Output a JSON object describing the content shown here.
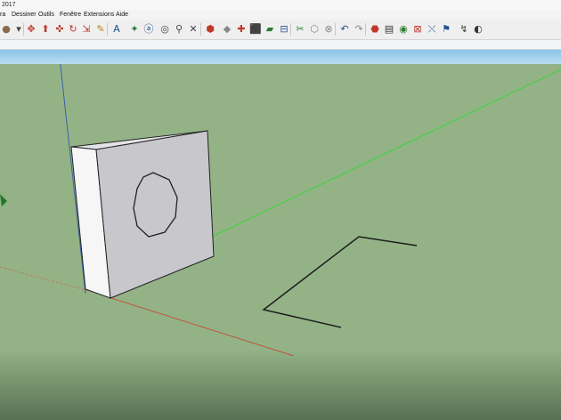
{
  "window": {
    "title": "2017"
  },
  "menu": {
    "items": [
      {
        "label": "ra"
      },
      {
        "label": "Dessiner"
      },
      {
        "label": "Outils"
      },
      {
        "label": "Fenêtre"
      },
      {
        "label": "Extensions"
      },
      {
        "label": "Aide"
      }
    ]
  },
  "toolbar": {
    "icons": [
      {
        "name": "paint-bucket-icon",
        "glyph": "●",
        "color": "#8a6a4a"
      },
      {
        "name": "dropdown-arrow-icon",
        "glyph": "▾",
        "color": "#444444"
      },
      {
        "name": "move-tool-icon",
        "glyph": "✥",
        "color": "#c0392b"
      },
      {
        "name": "push-pull-icon",
        "glyph": "⬆",
        "color": "#c0392b"
      },
      {
        "name": "move-icon",
        "glyph": "✜",
        "color": "#c0392b"
      },
      {
        "name": "rotate-icon",
        "glyph": "↻",
        "color": "#c0392b"
      },
      {
        "name": "scale-icon",
        "glyph": "⇲",
        "color": "#c0392b"
      },
      {
        "name": "tape-measure-icon",
        "glyph": "✎",
        "color": "#b8860b"
      },
      {
        "name": "text-icon",
        "glyph": "A",
        "color": "#1f4e8c"
      },
      {
        "name": "axes-icon",
        "glyph": "✦",
        "color": "#2e7d32"
      },
      {
        "name": "3d-text-icon",
        "glyph": "ⓐ",
        "color": "#1f4e8c"
      },
      {
        "name": "orbit-icon",
        "glyph": "◎",
        "color": "#444444"
      },
      {
        "name": "zoom-icon",
        "glyph": "⚲",
        "color": "#444444"
      },
      {
        "name": "zoom-extents-icon",
        "glyph": "✕",
        "color": "#444444"
      },
      {
        "name": "warehouse-icon",
        "glyph": "⬢",
        "color": "#c0392b"
      },
      {
        "name": "share-model-icon",
        "glyph": "◆",
        "color": "#888888"
      },
      {
        "name": "extension-warehouse-icon",
        "glyph": "✚",
        "color": "#c0392b"
      },
      {
        "name": "components-icon",
        "glyph": "⬛",
        "color": "#c0392b"
      },
      {
        "name": "materials-icon",
        "glyph": "▰",
        "color": "#2e7d32"
      },
      {
        "name": "layers-icon",
        "glyph": "⊟",
        "color": "#1f4e8c"
      },
      {
        "name": "section-plane-icon",
        "glyph": "✂",
        "color": "#2e7d32"
      },
      {
        "name": "section-display-icon",
        "glyph": "⬡",
        "color": "#888888"
      },
      {
        "name": "section-cut-icon",
        "glyph": "⊗",
        "color": "#888888"
      },
      {
        "name": "undo-icon",
        "glyph": "↶",
        "color": "#1f4e8c"
      },
      {
        "name": "redo-icon",
        "glyph": "↷",
        "color": "#888888"
      },
      {
        "name": "model-info-icon",
        "glyph": "⬣",
        "color": "#c0392b"
      },
      {
        "name": "print-icon",
        "glyph": "▤",
        "color": "#333333"
      },
      {
        "name": "camera-icon",
        "glyph": "◉",
        "color": "#2e7d32"
      },
      {
        "name": "zoom-window-icon",
        "glyph": "⊠",
        "color": "#c0392b"
      },
      {
        "name": "previous-view-icon",
        "glyph": "⤬",
        "color": "#1f4e8c"
      },
      {
        "name": "position-camera-icon",
        "glyph": "⚑",
        "color": "#1f4e8c"
      },
      {
        "name": "walk-icon",
        "glyph": "↯",
        "color": "#444444"
      },
      {
        "name": "look-around-icon",
        "glyph": "◐",
        "color": "#333333"
      }
    ]
  },
  "viewport": {
    "background_color": "#93b387",
    "sky_color": "#a6d2ee"
  }
}
